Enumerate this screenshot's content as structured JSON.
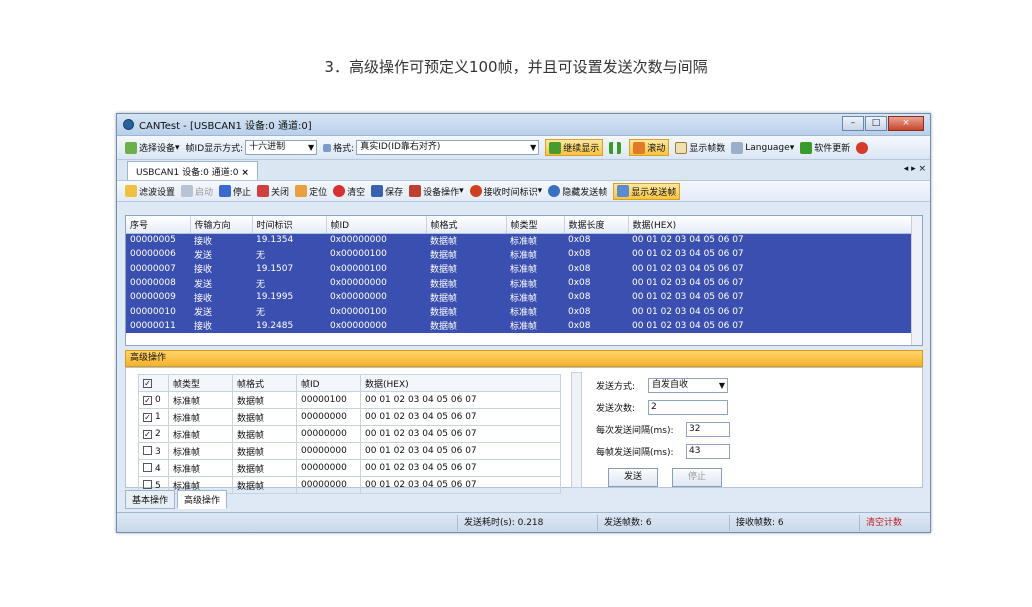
{
  "caption": "3．高级操作可预定义100帧，并且可设置发送次数与间隔",
  "window": {
    "title": "CANTest - [USBCAN1 设备:0 通道:0]",
    "controls": [
      "–",
      "□",
      "×"
    ]
  },
  "toolbar1": {
    "select_device": "选择设备",
    "frameid_mode_label": "帧ID显示方式:",
    "frameid_mode_value": "十六进制",
    "format_label": "格式:",
    "format_value": "真实ID(ID靠右对齐)",
    "continue_display": "继续显示",
    "pause_icon": "pause-icon",
    "scroll": "滚动",
    "show_frames": "显示帧数",
    "language": "Language",
    "software_update": "软件更新"
  },
  "tab": {
    "label": "USBCAN1 设备:0 通道:0",
    "close": "×",
    "nav": "◂ ▸ ×"
  },
  "toolbar2": {
    "filter": "滤波设置",
    "start": "启动",
    "stop": "停止",
    "close": "关闭",
    "locate": "定位",
    "clear": "清空",
    "save": "保存",
    "device_op": "设备操作",
    "recv_time": "接收时间标识",
    "hide_send": "隐藏发送帧",
    "show_send": "显示发送帧"
  },
  "grid": {
    "headers": [
      "序号",
      "传输方向",
      "时间标识",
      "帧ID",
      "帧格式",
      "帧类型",
      "数据长度",
      "数据(HEX)"
    ],
    "rows": [
      [
        "00000005",
        "接收",
        "19.1354",
        "0x00000000",
        "数据帧",
        "标准帧",
        "0x08",
        "00 01 02 03 04 05 06 07"
      ],
      [
        "00000006",
        "发送",
        "无",
        "0x00000100",
        "数据帧",
        "标准帧",
        "0x08",
        "00 01 02 03 04 05 06 07"
      ],
      [
        "00000007",
        "接收",
        "19.1507",
        "0x00000100",
        "数据帧",
        "标准帧",
        "0x08",
        "00 01 02 03 04 05 06 07"
      ],
      [
        "00000008",
        "发送",
        "无",
        "0x00000000",
        "数据帧",
        "标准帧",
        "0x08",
        "00 01 02 03 04 05 06 07"
      ],
      [
        "00000009",
        "接收",
        "19.1995",
        "0x00000000",
        "数据帧",
        "标准帧",
        "0x08",
        "00 01 02 03 04 05 06 07"
      ],
      [
        "00000010",
        "发送",
        "无",
        "0x00000100",
        "数据帧",
        "标准帧",
        "0x08",
        "00 01 02 03 04 05 06 07"
      ],
      [
        "00000011",
        "接收",
        "19.2485",
        "0x00000000",
        "数据帧",
        "标准帧",
        "0x08",
        "00 01 02 03 04 05 06 07"
      ]
    ]
  },
  "advanced": {
    "title": "高级操作",
    "headers": [
      "帧类型",
      "帧格式",
      "帧ID",
      "数据(HEX)"
    ],
    "rows": [
      {
        "idx": "0",
        "checked": true,
        "type": "标准帧",
        "format": "数据帧",
        "id": "00000100",
        "data": "00 01 02 03 04 05 06 07"
      },
      {
        "idx": "1",
        "checked": true,
        "type": "标准帧",
        "format": "数据帧",
        "id": "00000000",
        "data": "00 01 02 03 04 05 06 07"
      },
      {
        "idx": "2",
        "checked": true,
        "type": "标准帧",
        "format": "数据帧",
        "id": "00000000",
        "data": "00 01 02 03 04 05 06 07"
      },
      {
        "idx": "3",
        "checked": false,
        "type": "标准帧",
        "format": "数据帧",
        "id": "00000000",
        "data": "00 01 02 03 04 05 06 07"
      },
      {
        "idx": "4",
        "checked": false,
        "type": "标准帧",
        "format": "数据帧",
        "id": "00000000",
        "data": "00 01 02 03 04 05 06 07"
      },
      {
        "idx": "5",
        "checked": false,
        "type": "标准帧",
        "format": "数据帧",
        "id": "00000000",
        "data": "00 01 02 03 04 05 06 07"
      }
    ],
    "send_mode_label": "发送方式:",
    "send_mode_value": "自发自收",
    "send_count_label": "发送次数:",
    "send_count_value": "2",
    "interval_label": "每次发送间隔(ms):",
    "interval_value": "32",
    "frame_interval_label": "每帧发送间隔(ms):",
    "frame_interval_value": "43",
    "send_btn": "发送",
    "stop_btn": "停止"
  },
  "bottom_tabs": [
    "基本操作",
    "高级操作"
  ],
  "status": {
    "send_time": "发送耗时(s): 0.218",
    "send_frames": "发送帧数: 6",
    "recv_frames": "接收帧数: 6",
    "clear_count": "清空计数"
  }
}
